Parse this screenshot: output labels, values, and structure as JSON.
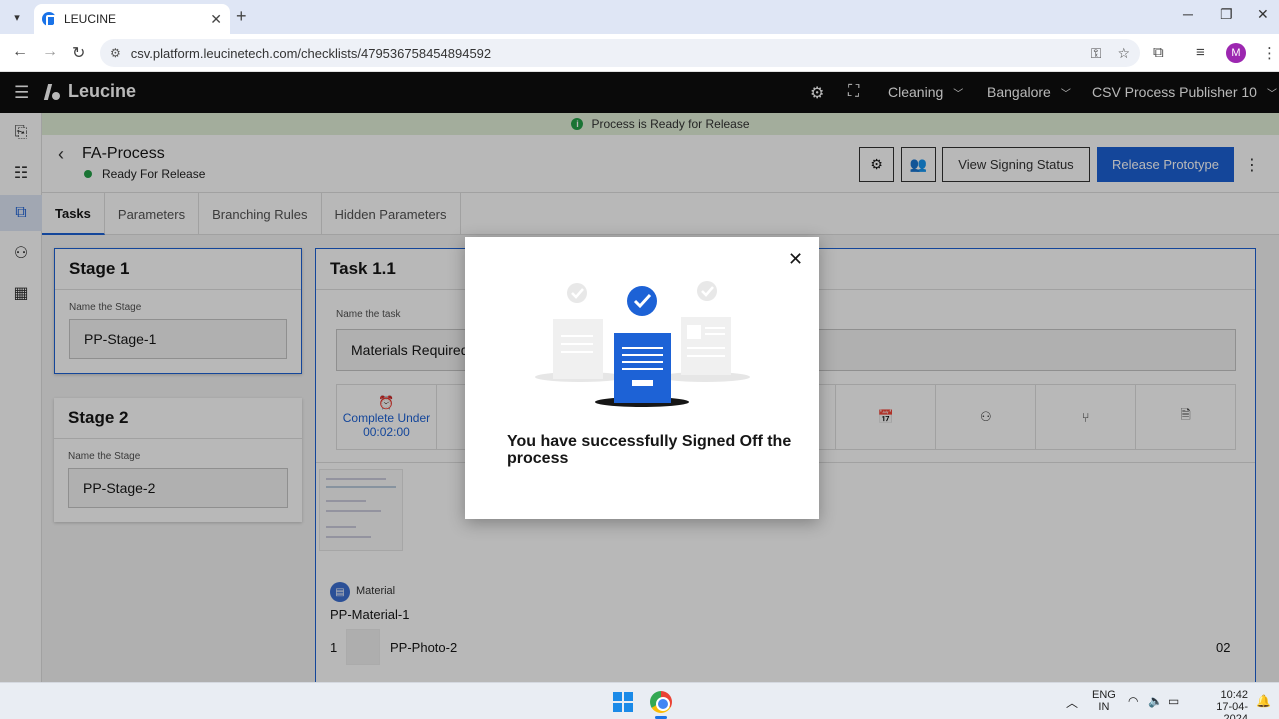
{
  "browser": {
    "tab_title": "LEUCINE",
    "url": "csv.platform.leucinetech.com/checklists/479536758454894592",
    "profile_initial": "M"
  },
  "header": {
    "brand": "Leucine",
    "facility": "Cleaning",
    "location": "Bangalore",
    "user": "CSV Process Publisher 10"
  },
  "banner": {
    "text": "Process is Ready for Release"
  },
  "process": {
    "title": "FA-Process",
    "status": "Ready For Release",
    "status_color": "#24a148",
    "view_signing_label": "View Signing Status",
    "release_label": "Release Prototype"
  },
  "tabs": [
    "Tasks",
    "Parameters",
    "Branching Rules",
    "Hidden Parameters"
  ],
  "stages": [
    {
      "title": "Stage 1",
      "field_label": "Name the Stage",
      "value": "PP-Stage-1"
    },
    {
      "title": "Stage 2",
      "field_label": "Name the Stage",
      "value": "PP-Stage-2"
    }
  ],
  "task": {
    "title": "Task 1.1",
    "field_label": "Name the task",
    "value": "Materials Required",
    "timer_label": "Complete Under",
    "timer_value": "00:02:00",
    "material_label": "Material",
    "material_name": "PP-Material-1",
    "row_index": "1",
    "row_name": "PP-Photo-2",
    "row_qty": "02"
  },
  "modal": {
    "message": "You have successfully Signed Off the process"
  },
  "taskbar": {
    "lang_top": "ENG",
    "lang_bottom": "IN",
    "time": "10:42",
    "date": "17-04-2024"
  },
  "colors": {
    "primary": "#1d62d6",
    "appbar": "#0f0f0f",
    "banner_bg": "#e2f0d9"
  }
}
